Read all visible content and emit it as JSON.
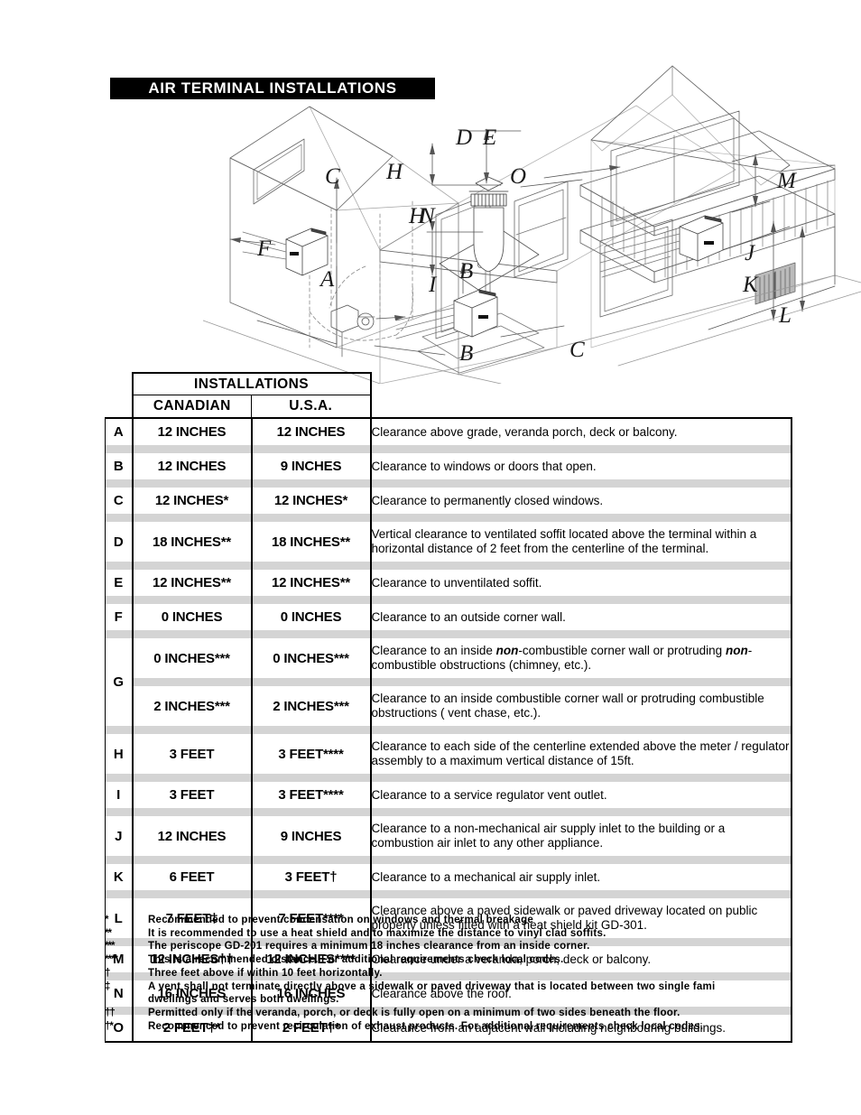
{
  "title": {
    "banner": "AIR TERMINAL INSTALLATIONS"
  },
  "illustration": {
    "name": "isometric-house-vent-clearance-diagram",
    "labels": [
      {
        "id": "A",
        "text": "A"
      },
      {
        "id": "B1",
        "text": "B"
      },
      {
        "id": "B2",
        "text": "B"
      },
      {
        "id": "C1",
        "text": "C"
      },
      {
        "id": "C2",
        "text": "C"
      },
      {
        "id": "D",
        "text": "D"
      },
      {
        "id": "E",
        "text": "E"
      },
      {
        "id": "F",
        "text": "F"
      },
      {
        "id": "H1",
        "text": "H"
      },
      {
        "id": "H2",
        "text": "H"
      },
      {
        "id": "I",
        "text": "I"
      },
      {
        "id": "J",
        "text": "J"
      },
      {
        "id": "K",
        "text": "K"
      },
      {
        "id": "L",
        "text": "L"
      },
      {
        "id": "M",
        "text": "M"
      },
      {
        "id": "N",
        "text": "N"
      },
      {
        "id": "O",
        "text": "O"
      }
    ]
  },
  "table": {
    "group_header": "INSTALLATIONS",
    "columns": [
      "CANADIAN",
      "U.S.A."
    ],
    "rows": [
      {
        "letter": "A",
        "canadian": "12 INCHES",
        "usa": "12 INCHES",
        "description": "Clearance above grade, veranda porch, deck or balcony."
      },
      {
        "letter": "B",
        "canadian": "12 INCHES",
        "usa": "9 INCHES",
        "description": "Clearance to windows or doors that open."
      },
      {
        "letter": "C",
        "canadian": "12 INCHES*",
        "usa": "12 INCHES*",
        "description": "Clearance to permanently closed windows."
      },
      {
        "letter": "D",
        "canadian": "18 INCHES**",
        "usa": "18 INCHES**",
        "description": "Vertical clearance to ventilated soffit located above the terminal within a horizontal distance of 2 feet from the centerline of the terminal."
      },
      {
        "letter": "E",
        "canadian": "12 INCHES**",
        "usa": "12 INCHES**",
        "description": "Clearance to unventilated soffit."
      },
      {
        "letter": "F",
        "canadian": "0 INCHES",
        "usa": "0 INCHES",
        "description": "Clearance to an outside corner wall."
      },
      {
        "letter": "G",
        "canadian": "0 INCHES***",
        "usa": "0 INCHES***",
        "description_pre": "Clearance to an inside ",
        "description_em": "non",
        "description_mid": "-combustible corner wall or protruding ",
        "description_em2": "non",
        "description_post": "-combustible obstructions (chimney, etc.)."
      },
      {
        "letter": "G",
        "canadian": "2 INCHES***",
        "usa": "2 INCHES***",
        "description": "Clearance to an inside combustible corner wall or protruding combustible obstructions ( vent chase, etc.)."
      },
      {
        "letter": "H",
        "canadian": "3 FEET",
        "usa": "3 FEET****",
        "description": "Clearance to each side of the centerline extended above the meter / regulator assembly to a maximum vertical distance of 15ft."
      },
      {
        "letter": "I",
        "canadian": "3 FEET",
        "usa": "3 FEET****",
        "description": "Clearance to a service regulator vent outlet."
      },
      {
        "letter": "J",
        "canadian": "12 INCHES",
        "usa": "9 INCHES",
        "description": "Clearance to a non-mechanical air supply inlet to the building or a combustion air inlet to any other appliance."
      },
      {
        "letter": "K",
        "canadian": "6 FEET",
        "usa": "3 FEET†",
        "description": "Clearance to a mechanical air supply inlet."
      },
      {
        "letter": "L",
        "canadian": "7 FEET‡",
        "usa": "7 FEET****",
        "description": "Clearance above a paved sidewalk or paved driveway located on public property unless fitted with a heat shield kit GD-301."
      },
      {
        "letter": "M",
        "canadian": "12 INCHES††",
        "usa": "12 INCHES****",
        "description": "Clearance under a veranda, porch, deck or balcony."
      },
      {
        "letter": "N",
        "canadian": "16 INCHES",
        "usa": "16 INCHES",
        "description": "Clearance above the roof."
      },
      {
        "letter": "O",
        "canadian": "2 FEET†*",
        "usa": "2 FEET†*",
        "description": "Clearance from an adjacent wall including neighbouring buildings."
      }
    ]
  },
  "footnotes": [
    {
      "mark": "*",
      "text": "Recommended to prevent condensation on windows and thermal breakage"
    },
    {
      "mark": "**",
      "text": "It is recommended to use a heat shield and to maximize the distance to vinyl clad soffits."
    },
    {
      "mark": "***",
      "text": "The periscope GD-201 requires a minimum 18 inches clearance from an inside corner."
    },
    {
      "mark": "****",
      "text": "This is a recommended distance. For additional requirements check local codes."
    },
    {
      "mark": "†",
      "text": "Three feet above if within 10 feet horizontally."
    },
    {
      "mark": "‡",
      "text": "A vent shall not terminate directly above a sidewalk or paved driveway that is located between two single fami",
      "text2": "dwellings and serves both dwellings."
    },
    {
      "mark": "††",
      "text": "Permitted only if the veranda, porch, or deck is fully open on a minimum of two sides beneath the floor."
    },
    {
      "mark": "†*",
      "text": "Recommenced to prevent recirculation of exhaust products. For additional requirements check local codes."
    }
  ]
}
